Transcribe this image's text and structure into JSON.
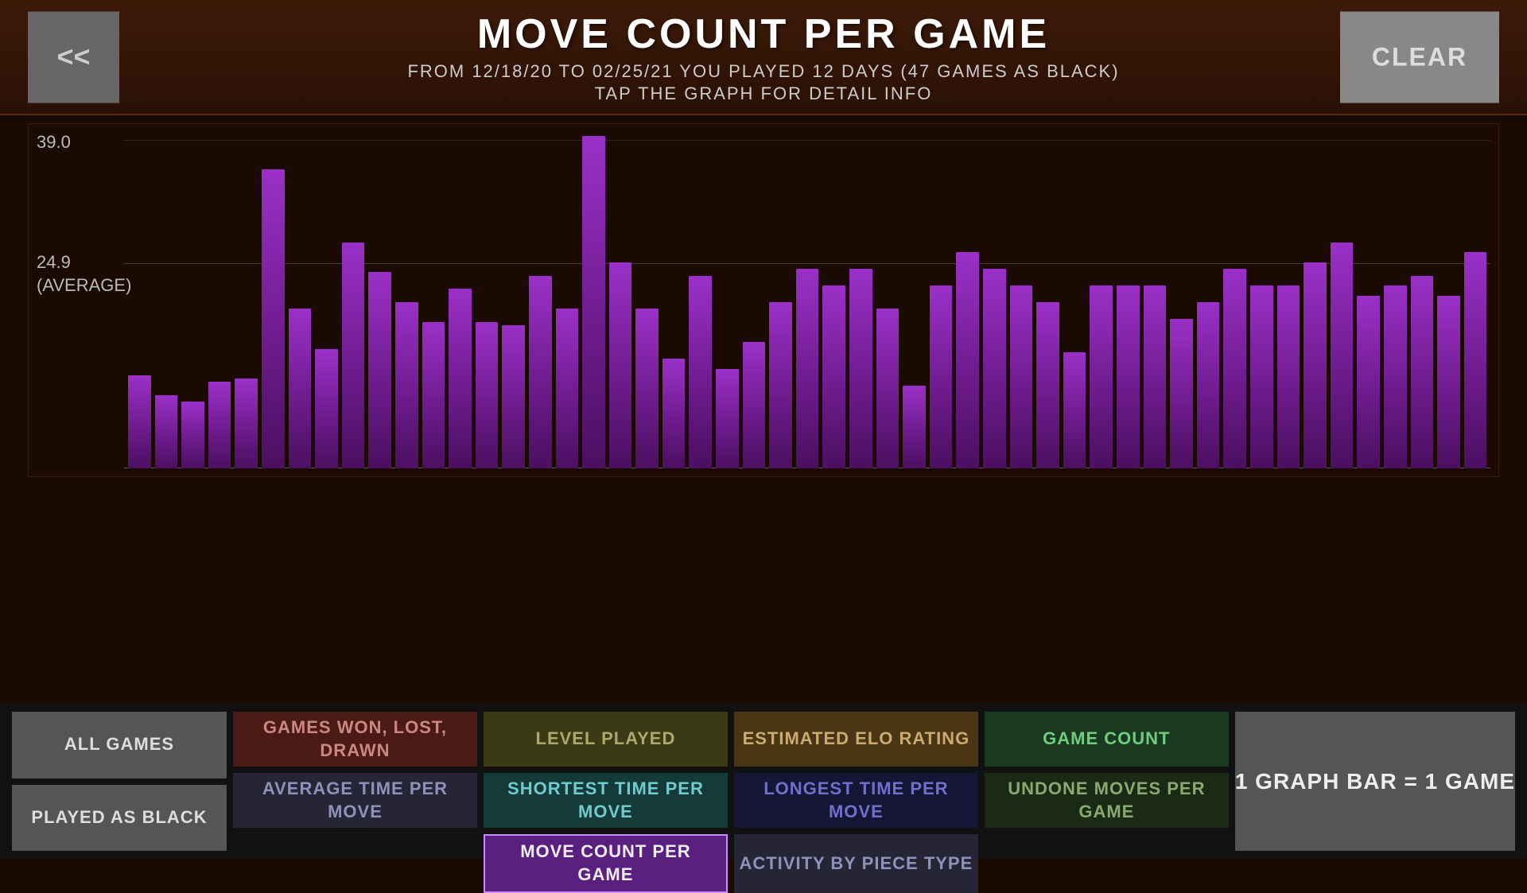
{
  "header": {
    "title": "MOVE COUNT PER GAME",
    "subtitle": "FROM 12/18/20 TO 02/25/21 YOU PLAYED 12 DAYS (47 GAMES AS BLACK)",
    "tap_hint": "TAP THE GRAPH FOR DETAIL INFO",
    "back_label": "<<",
    "clear_label": "CLEAR"
  },
  "chart": {
    "max_label": "39.0",
    "avg_label": "24.9",
    "avg_sublabel": "(AVERAGE)",
    "bars": [
      28,
      22,
      20,
      26,
      27,
      90,
      48,
      36,
      68,
      59,
      50,
      44,
      54,
      44,
      43,
      58,
      48,
      100,
      62,
      48,
      33,
      58,
      30,
      38,
      50,
      60,
      55,
      60,
      48,
      25,
      55,
      65,
      60,
      55,
      50,
      35,
      55,
      55,
      55,
      45,
      50,
      60,
      55,
      55,
      62,
      68,
      52,
      55,
      58,
      52,
      65
    ]
  },
  "buttons": {
    "all_games": "ALL\nGAMES",
    "played_as_black": "PLAYED AS\nBLACK",
    "games_won": "GAMES WON,\nLOST, DRAWN",
    "level_played": "LEVEL\nPLAYED",
    "estimated_elo": "ESTIMATED\nELO RATING",
    "game_count": "GAME\nCOUNT",
    "average_time": "AVERAGE TIME\nPER MOVE",
    "shortest_time": "SHORTEST TIME\nPER MOVE",
    "longest_time": "LONGEST TIME\nPER MOVE",
    "undone_moves": "UNDONE MOVES\nPER GAME",
    "move_count": "MOVE COUNT\nPER GAME",
    "activity_by": "ACTIVITY BY\nPIECE TYPE",
    "graph_bar": "1 GRAPH BAR\n=\n1 GAME"
  }
}
